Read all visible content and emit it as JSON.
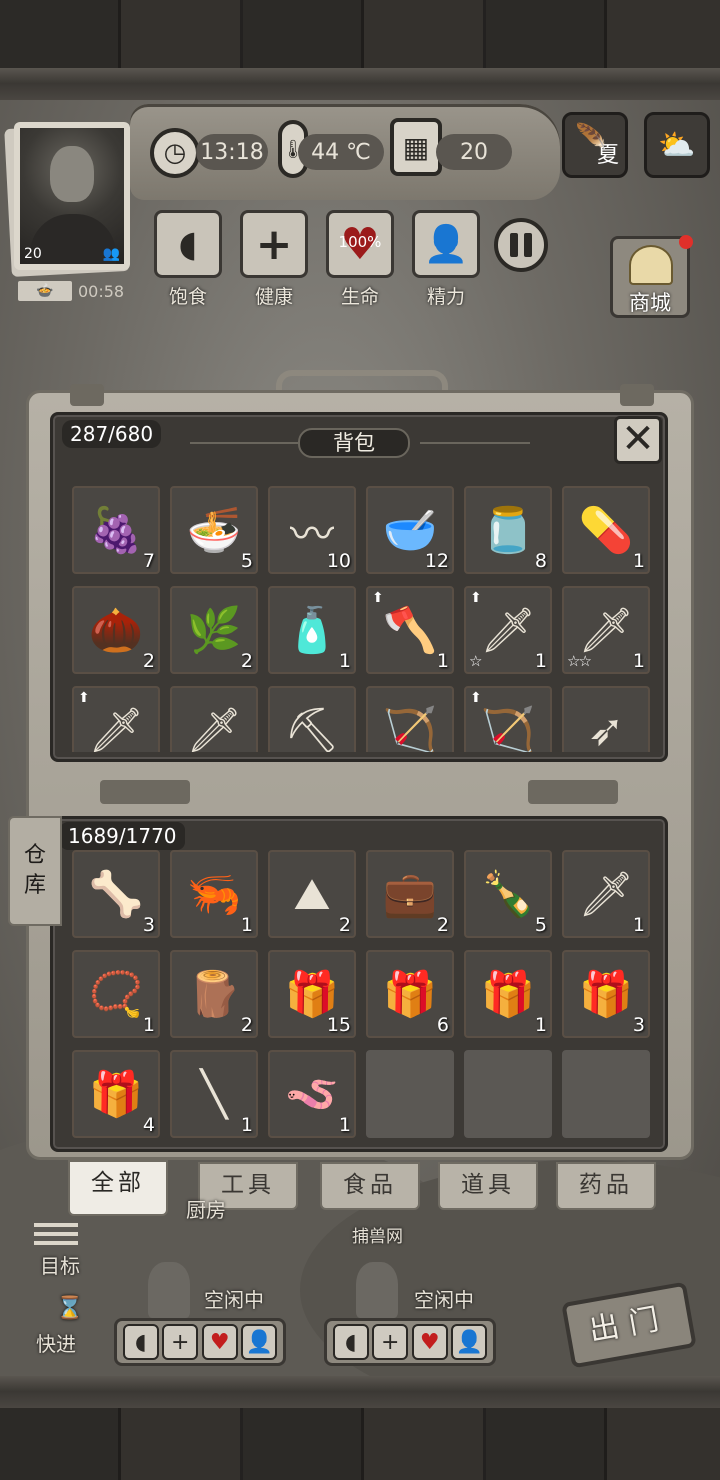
{
  "hud": {
    "time": "13:18",
    "temperature": "44 ℃",
    "day": "20",
    "season": "夏",
    "player_level": "20",
    "cook_timer": "00:58"
  },
  "stats": {
    "hunger_label": "饱食",
    "health_label": "健康",
    "life_label": "生命",
    "life_value": "100%",
    "energy_label": "精力"
  },
  "shop": {
    "label": "商城"
  },
  "backpack": {
    "title": "背包",
    "capacity": "287/680",
    "items": [
      {
        "icon": "berries-icon",
        "glyph": "🍇",
        "count": "7"
      },
      {
        "icon": "cooked-intestine-icon",
        "glyph": "🍜",
        "count": "5"
      },
      {
        "icon": "cloth-strip-icon",
        "glyph": "〰",
        "count": "10"
      },
      {
        "icon": "soup-bowl-icon",
        "glyph": "🥣",
        "count": "12"
      },
      {
        "icon": "specimen-jar-icon",
        "glyph": "🫙",
        "count": "8"
      },
      {
        "icon": "pills-icon",
        "glyph": "💊",
        "count": "1"
      },
      {
        "icon": "nuts-icon",
        "glyph": "🌰",
        "count": "2"
      },
      {
        "icon": "herb-pouch-icon",
        "glyph": "🌿",
        "count": "2"
      },
      {
        "icon": "medicine-bottle-icon",
        "glyph": "🧴",
        "count": "1"
      },
      {
        "icon": "axe-icon",
        "glyph": "🪓",
        "count": "1",
        "up": true
      },
      {
        "icon": "spear-icon",
        "glyph": "🗡",
        "count": "1",
        "up": true,
        "stars": "☆"
      },
      {
        "icon": "spear-icon",
        "glyph": "🗡",
        "count": "1",
        "stars": "☆☆"
      },
      {
        "icon": "spear-icon",
        "glyph": "🗡",
        "count": "",
        "up": true
      },
      {
        "icon": "spear-icon",
        "glyph": "🗡",
        "count": ""
      },
      {
        "icon": "pickaxe-icon",
        "glyph": "⛏",
        "count": ""
      },
      {
        "icon": "bow-icon",
        "glyph": "🏹",
        "count": ""
      },
      {
        "icon": "bow-icon",
        "glyph": "🏹",
        "count": "",
        "up": true
      },
      {
        "icon": "arrows-icon",
        "glyph": "➶",
        "count": ""
      }
    ]
  },
  "warehouse": {
    "tab_label": "仓库",
    "capacity": "1689/1770",
    "items": [
      {
        "icon": "horn-icon",
        "glyph": "🦴",
        "count": "3"
      },
      {
        "icon": "shrimp-icon",
        "glyph": "🦐",
        "count": "1"
      },
      {
        "icon": "salt-pile-icon",
        "glyph": "⛰",
        "count": "2"
      },
      {
        "icon": "leather-bag-icon",
        "glyph": "💼",
        "count": "2"
      },
      {
        "icon": "bottle-icon",
        "glyph": "🍾",
        "count": "5"
      },
      {
        "icon": "dagger-icon",
        "glyph": "🗡",
        "count": "1"
      },
      {
        "icon": "amulet-icon",
        "glyph": "📿",
        "count": "1"
      },
      {
        "icon": "wood-plank-icon",
        "glyph": "🪵",
        "count": "2"
      },
      {
        "icon": "gift-box-food-icon",
        "glyph": "🎁",
        "count": "15"
      },
      {
        "icon": "gift-box-medical-icon",
        "glyph": "🎁",
        "count": "6"
      },
      {
        "icon": "gift-box-tools-icon",
        "glyph": "🎁",
        "count": "1"
      },
      {
        "icon": "gift-box-hammer-icon",
        "glyph": "🎁",
        "count": "3"
      },
      {
        "icon": "gift-box-lumber-icon",
        "glyph": "🎁",
        "count": "4"
      },
      {
        "icon": "iron-rod-icon",
        "glyph": "╲",
        "count": "1"
      },
      {
        "icon": "worm-icon",
        "glyph": "🪱",
        "count": "1"
      },
      {
        "icon": "empty-slot",
        "glyph": "",
        "count": ""
      },
      {
        "icon": "empty-slot",
        "glyph": "",
        "count": ""
      },
      {
        "icon": "empty-slot",
        "glyph": "",
        "count": ""
      }
    ]
  },
  "tabs": [
    {
      "label": "全部",
      "active": true
    },
    {
      "label": "工具",
      "active": false
    },
    {
      "label": "食品",
      "active": false
    },
    {
      "label": "道具",
      "active": false
    },
    {
      "label": "药品",
      "active": false
    }
  ],
  "scene": {
    "kitchen_label": "厨房",
    "trap_label": "捕兽网",
    "goal_label": "目标",
    "fastforward_label": "快进",
    "char1_status": "空闲中",
    "char2_status": "空闲中",
    "go_out_label": "出门"
  }
}
